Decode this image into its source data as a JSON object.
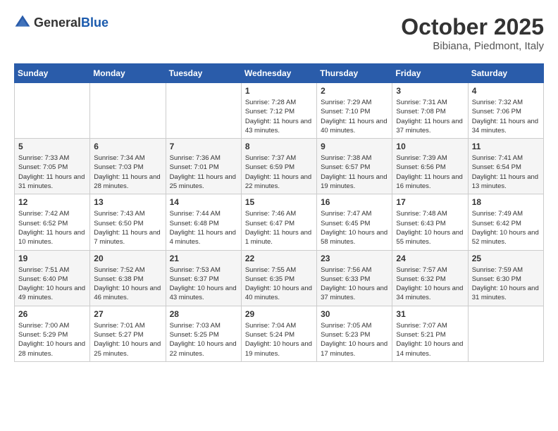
{
  "header": {
    "logo_general": "General",
    "logo_blue": "Blue",
    "month_title": "October 2025",
    "location": "Bibiana, Piedmont, Italy"
  },
  "days_of_week": [
    "Sunday",
    "Monday",
    "Tuesday",
    "Wednesday",
    "Thursday",
    "Friday",
    "Saturday"
  ],
  "weeks": [
    [
      {
        "day": "",
        "sunrise": "",
        "sunset": "",
        "daylight": ""
      },
      {
        "day": "",
        "sunrise": "",
        "sunset": "",
        "daylight": ""
      },
      {
        "day": "",
        "sunrise": "",
        "sunset": "",
        "daylight": ""
      },
      {
        "day": "1",
        "sunrise": "Sunrise: 7:28 AM",
        "sunset": "Sunset: 7:12 PM",
        "daylight": "Daylight: 11 hours and 43 minutes."
      },
      {
        "day": "2",
        "sunrise": "Sunrise: 7:29 AM",
        "sunset": "Sunset: 7:10 PM",
        "daylight": "Daylight: 11 hours and 40 minutes."
      },
      {
        "day": "3",
        "sunrise": "Sunrise: 7:31 AM",
        "sunset": "Sunset: 7:08 PM",
        "daylight": "Daylight: 11 hours and 37 minutes."
      },
      {
        "day": "4",
        "sunrise": "Sunrise: 7:32 AM",
        "sunset": "Sunset: 7:06 PM",
        "daylight": "Daylight: 11 hours and 34 minutes."
      }
    ],
    [
      {
        "day": "5",
        "sunrise": "Sunrise: 7:33 AM",
        "sunset": "Sunset: 7:05 PM",
        "daylight": "Daylight: 11 hours and 31 minutes."
      },
      {
        "day": "6",
        "sunrise": "Sunrise: 7:34 AM",
        "sunset": "Sunset: 7:03 PM",
        "daylight": "Daylight: 11 hours and 28 minutes."
      },
      {
        "day": "7",
        "sunrise": "Sunrise: 7:36 AM",
        "sunset": "Sunset: 7:01 PM",
        "daylight": "Daylight: 11 hours and 25 minutes."
      },
      {
        "day": "8",
        "sunrise": "Sunrise: 7:37 AM",
        "sunset": "Sunset: 6:59 PM",
        "daylight": "Daylight: 11 hours and 22 minutes."
      },
      {
        "day": "9",
        "sunrise": "Sunrise: 7:38 AM",
        "sunset": "Sunset: 6:57 PM",
        "daylight": "Daylight: 11 hours and 19 minutes."
      },
      {
        "day": "10",
        "sunrise": "Sunrise: 7:39 AM",
        "sunset": "Sunset: 6:56 PM",
        "daylight": "Daylight: 11 hours and 16 minutes."
      },
      {
        "day": "11",
        "sunrise": "Sunrise: 7:41 AM",
        "sunset": "Sunset: 6:54 PM",
        "daylight": "Daylight: 11 hours and 13 minutes."
      }
    ],
    [
      {
        "day": "12",
        "sunrise": "Sunrise: 7:42 AM",
        "sunset": "Sunset: 6:52 PM",
        "daylight": "Daylight: 11 hours and 10 minutes."
      },
      {
        "day": "13",
        "sunrise": "Sunrise: 7:43 AM",
        "sunset": "Sunset: 6:50 PM",
        "daylight": "Daylight: 11 hours and 7 minutes."
      },
      {
        "day": "14",
        "sunrise": "Sunrise: 7:44 AM",
        "sunset": "Sunset: 6:48 PM",
        "daylight": "Daylight: 11 hours and 4 minutes."
      },
      {
        "day": "15",
        "sunrise": "Sunrise: 7:46 AM",
        "sunset": "Sunset: 6:47 PM",
        "daylight": "Daylight: 11 hours and 1 minute."
      },
      {
        "day": "16",
        "sunrise": "Sunrise: 7:47 AM",
        "sunset": "Sunset: 6:45 PM",
        "daylight": "Daylight: 10 hours and 58 minutes."
      },
      {
        "day": "17",
        "sunrise": "Sunrise: 7:48 AM",
        "sunset": "Sunset: 6:43 PM",
        "daylight": "Daylight: 10 hours and 55 minutes."
      },
      {
        "day": "18",
        "sunrise": "Sunrise: 7:49 AM",
        "sunset": "Sunset: 6:42 PM",
        "daylight": "Daylight: 10 hours and 52 minutes."
      }
    ],
    [
      {
        "day": "19",
        "sunrise": "Sunrise: 7:51 AM",
        "sunset": "Sunset: 6:40 PM",
        "daylight": "Daylight: 10 hours and 49 minutes."
      },
      {
        "day": "20",
        "sunrise": "Sunrise: 7:52 AM",
        "sunset": "Sunset: 6:38 PM",
        "daylight": "Daylight: 10 hours and 46 minutes."
      },
      {
        "day": "21",
        "sunrise": "Sunrise: 7:53 AM",
        "sunset": "Sunset: 6:37 PM",
        "daylight": "Daylight: 10 hours and 43 minutes."
      },
      {
        "day": "22",
        "sunrise": "Sunrise: 7:55 AM",
        "sunset": "Sunset: 6:35 PM",
        "daylight": "Daylight: 10 hours and 40 minutes."
      },
      {
        "day": "23",
        "sunrise": "Sunrise: 7:56 AM",
        "sunset": "Sunset: 6:33 PM",
        "daylight": "Daylight: 10 hours and 37 minutes."
      },
      {
        "day": "24",
        "sunrise": "Sunrise: 7:57 AM",
        "sunset": "Sunset: 6:32 PM",
        "daylight": "Daylight: 10 hours and 34 minutes."
      },
      {
        "day": "25",
        "sunrise": "Sunrise: 7:59 AM",
        "sunset": "Sunset: 6:30 PM",
        "daylight": "Daylight: 10 hours and 31 minutes."
      }
    ],
    [
      {
        "day": "26",
        "sunrise": "Sunrise: 7:00 AM",
        "sunset": "Sunset: 5:29 PM",
        "daylight": "Daylight: 10 hours and 28 minutes."
      },
      {
        "day": "27",
        "sunrise": "Sunrise: 7:01 AM",
        "sunset": "Sunset: 5:27 PM",
        "daylight": "Daylight: 10 hours and 25 minutes."
      },
      {
        "day": "28",
        "sunrise": "Sunrise: 7:03 AM",
        "sunset": "Sunset: 5:25 PM",
        "daylight": "Daylight: 10 hours and 22 minutes."
      },
      {
        "day": "29",
        "sunrise": "Sunrise: 7:04 AM",
        "sunset": "Sunset: 5:24 PM",
        "daylight": "Daylight: 10 hours and 19 minutes."
      },
      {
        "day": "30",
        "sunrise": "Sunrise: 7:05 AM",
        "sunset": "Sunset: 5:23 PM",
        "daylight": "Daylight: 10 hours and 17 minutes."
      },
      {
        "day": "31",
        "sunrise": "Sunrise: 7:07 AM",
        "sunset": "Sunset: 5:21 PM",
        "daylight": "Daylight: 10 hours and 14 minutes."
      },
      {
        "day": "",
        "sunrise": "",
        "sunset": "",
        "daylight": ""
      }
    ]
  ]
}
